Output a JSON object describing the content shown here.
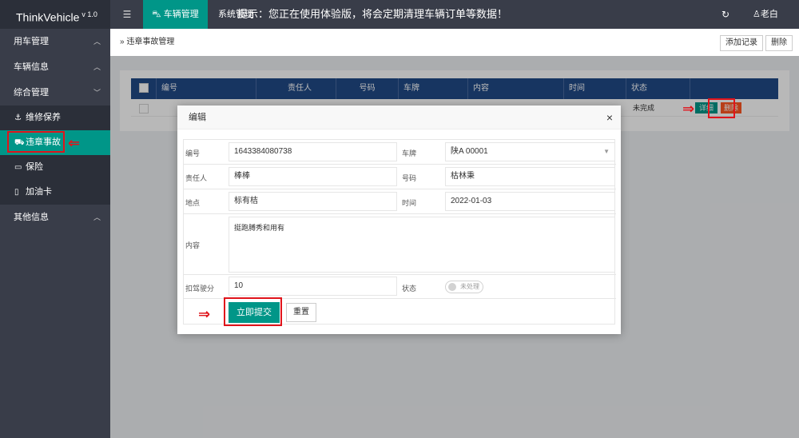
{
  "header": {
    "logo": "ThinkVehicle",
    "version": "v 1.0",
    "menu_icon": "menu-icon",
    "nav_active": "车辆管理",
    "nav_item": "系统管理",
    "notice": "提示：您正在使用体验版，将会定期清理车辆订单等数据！",
    "user": "老白"
  },
  "sidebar": {
    "groups": [
      {
        "label": "用车管理",
        "chev": "^"
      },
      {
        "label": "车辆信息",
        "chev": "^"
      },
      {
        "label": "综合管理",
        "chev": "v"
      }
    ],
    "subs": [
      {
        "label": "维修保养",
        "icon": "⚓"
      },
      {
        "label": "违章事故",
        "icon": "⛟"
      },
      {
        "label": "保险",
        "icon": "▭"
      },
      {
        "label": "加油卡",
        "icon": "▯"
      }
    ],
    "other": {
      "label": "其他信息",
      "chev": "^"
    }
  },
  "breadcrumb": {
    "sep": "»",
    "label": "违章事故管理",
    "add_label": "添加记录",
    "delete_label": "删除"
  },
  "table": {
    "headers": [
      "编号",
      "责任人",
      "号码",
      "车牌",
      "内容",
      "时间",
      "状态"
    ],
    "row": {
      "status": "未完成",
      "detail_label": "详细",
      "delete_label": "删除"
    }
  },
  "modal": {
    "title": "编辑",
    "close": "×",
    "fields": {
      "id_label": "编号",
      "id_value": "1643384080738",
      "plate_label": "车牌",
      "plate_value": "陕A 00001",
      "person_label": "责任人",
      "person_value": "棒棒",
      "number_label": "号码",
      "number_value": "枯林秉",
      "place_label": "地点",
      "place_value": "标有桔",
      "time_label": "时间",
      "time_value": "2022-01-03",
      "content_label": "内容",
      "content_value": "挺跑膊秀和用有",
      "points_label": "扣驾驶分",
      "points_value": "10",
      "status_label": "状态",
      "status_value": "未处理"
    },
    "submit_label": "立即提交",
    "reset_label": "重置"
  },
  "colors": {
    "accent": "#009688",
    "header": "#393d49",
    "annotation": "#e0141b",
    "danger": "#ff5722",
    "table_head": "#204a87"
  }
}
